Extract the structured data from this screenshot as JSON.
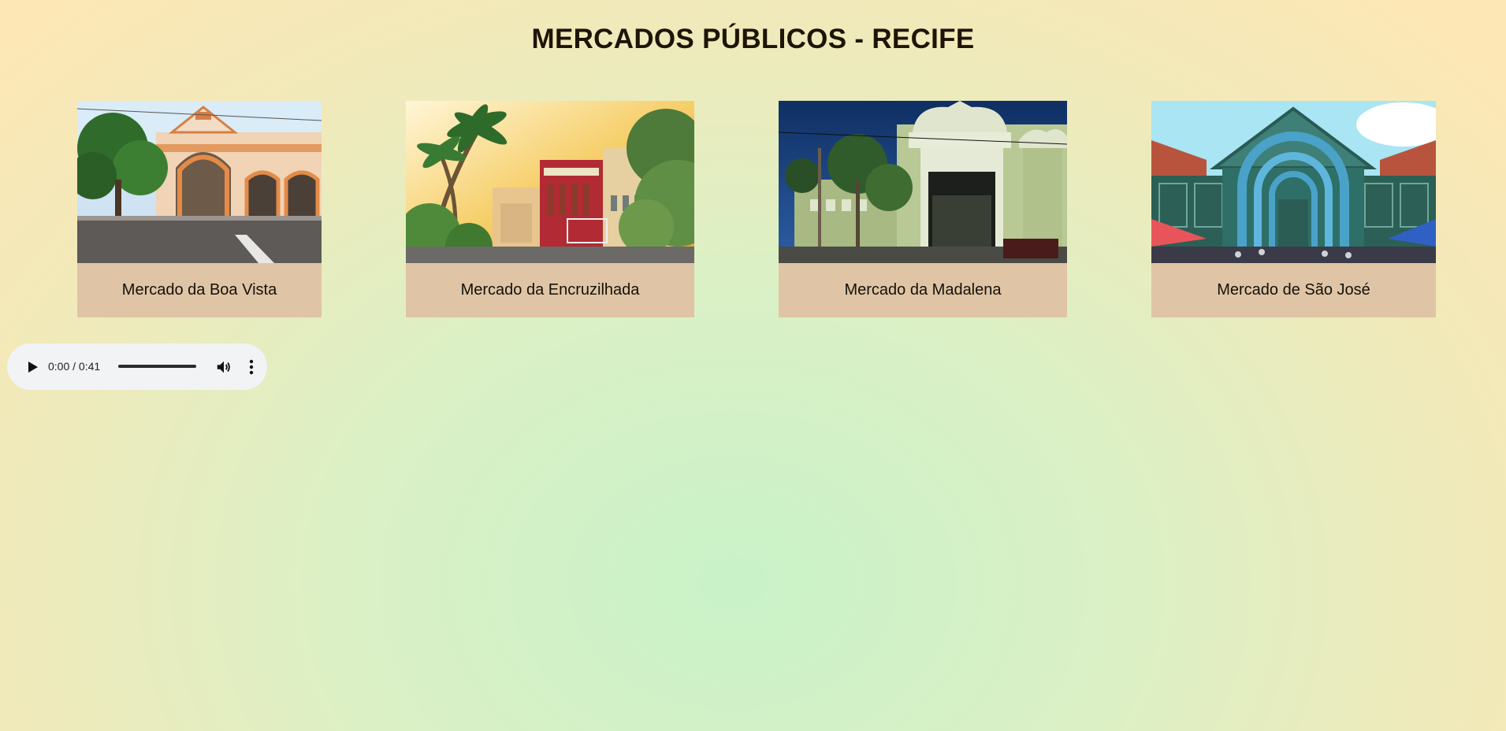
{
  "page": {
    "title": "MERCADOS PÚBLICOS - RECIFE"
  },
  "markets": [
    {
      "name": "Mercado da Boa Vista",
      "image": "arched-colonial-market-entrance-photo"
    },
    {
      "name": "Mercado da Encruzilhada",
      "image": "red-modernist-market-building-with-palms-photo"
    },
    {
      "name": "Mercado da Madalena",
      "image": "green-baroque-market-facade-photo"
    },
    {
      "name": "Mercado de São José",
      "image": "iron-market-hall-with-blue-arch-photo"
    }
  ],
  "audio": {
    "time": "0:00 / 0:41",
    "progress": 0,
    "icons": {
      "play": "play-icon",
      "volume": "volume-icon",
      "more": "more-options-icon"
    }
  },
  "colors": {
    "card_label_bg": "#dfc5a5",
    "title": "#1f1406",
    "player_bg": "#f1f3f4"
  }
}
